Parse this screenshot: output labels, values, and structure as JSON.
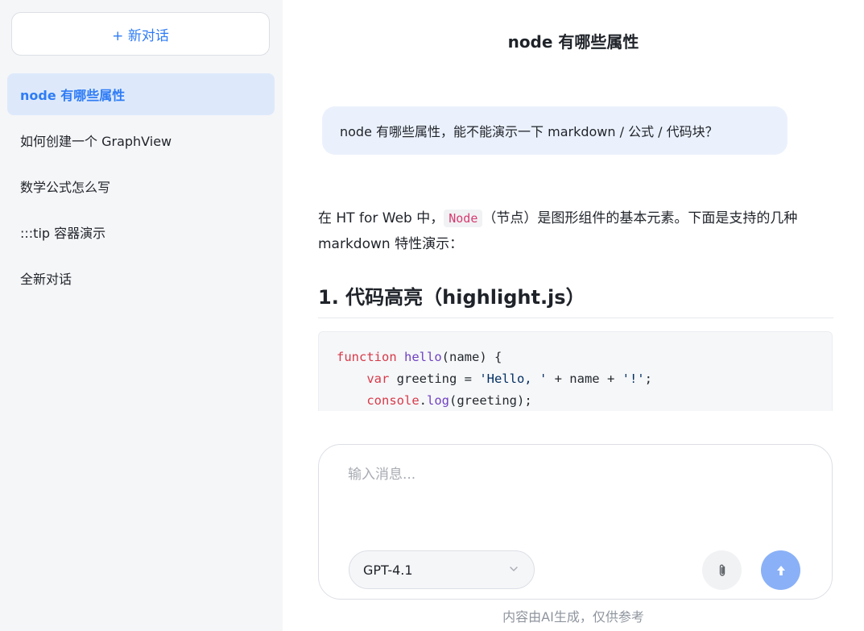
{
  "sidebar": {
    "new_chat_label": "+ 新对话",
    "conversations": [
      {
        "label": "node 有哪些属性",
        "active": true
      },
      {
        "label": "如何创建一个 GraphView",
        "active": false
      },
      {
        "label": "数学公式怎么写",
        "active": false
      },
      {
        "label": ":::tip 容器演示",
        "active": false
      },
      {
        "label": "全新对话",
        "active": false
      }
    ]
  },
  "chat": {
    "title": "node 有哪些属性",
    "user_message": "node 有哪些属性，能不能演示一下 markdown / 公式 / 代码块？",
    "answer": {
      "intro_before": "在 HT for Web 中，",
      "intro_code": "Node",
      "intro_after": "（节点）是图形组件的基本元素。下面是支持的几种 markdown 特性演示：",
      "heading": "1. 代码高亮（highlight.js）",
      "code_lines": [
        "function hello(name) {",
        "    var greeting = 'Hello, ' + name + '!';",
        "    console.log(greeting);"
      ]
    }
  },
  "composer": {
    "placeholder": "输入消息...",
    "model": "GPT-4.1",
    "attach_icon": "paperclip-icon",
    "send_icon": "arrow-up-icon"
  },
  "disclaimer": "内容由AI生成，仅供参考",
  "colors": {
    "accent": "#2f7cf6",
    "sidebar_bg": "#f5f6f8",
    "active_item_bg": "#dde9fb",
    "user_bubble_bg": "#ebf1fc",
    "send_button": "#8ab1f7"
  }
}
